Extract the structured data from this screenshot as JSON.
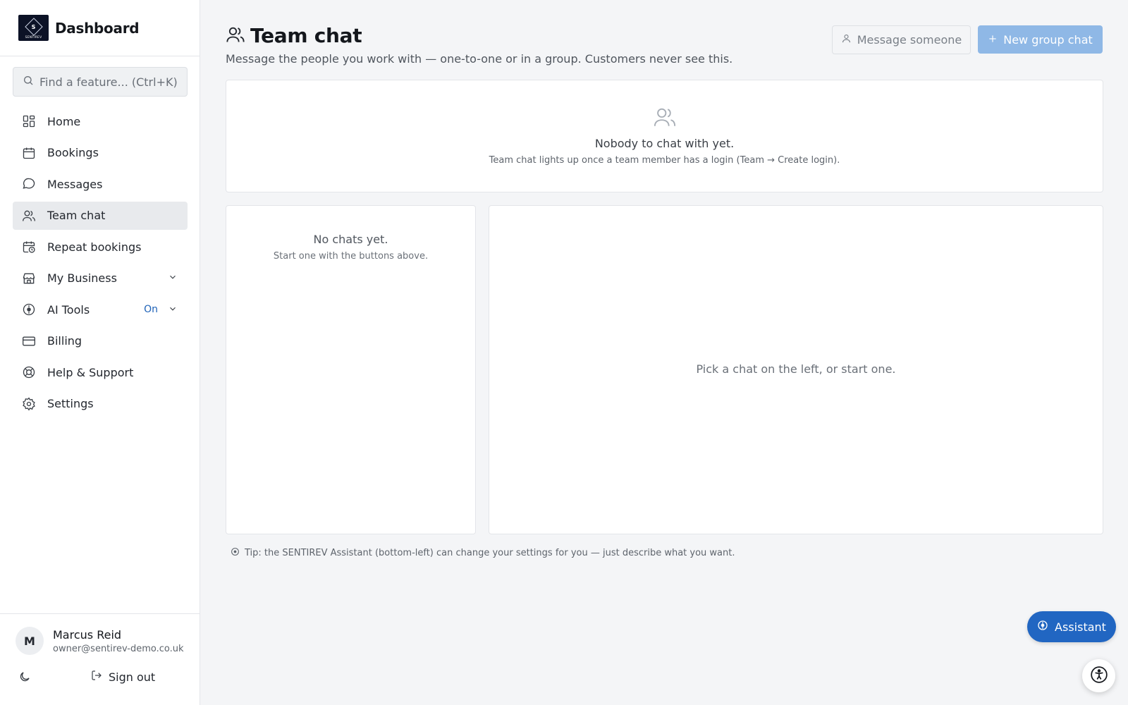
{
  "brand": {
    "title": "Dashboard",
    "logo_letter": "S",
    "logo_text": "SENTIREV"
  },
  "search": {
    "placeholder": "Find a feature...  (Ctrl+K)"
  },
  "sidebar": {
    "items": [
      {
        "label": "Home",
        "icon": "grid-icon"
      },
      {
        "label": "Bookings",
        "icon": "calendar-icon"
      },
      {
        "label": "Messages",
        "icon": "chat-bubble-icon"
      },
      {
        "label": "Team chat",
        "icon": "users-icon",
        "active": true
      },
      {
        "label": "Repeat bookings",
        "icon": "calendar-clock-icon"
      },
      {
        "label": "My Business",
        "icon": "store-icon",
        "expandable": true
      },
      {
        "label": "AI Tools",
        "icon": "ai-icon",
        "badge": "On",
        "expandable": true
      },
      {
        "label": "Billing",
        "icon": "credit-card-icon"
      },
      {
        "label": "Help & Support",
        "icon": "lifebuoy-icon"
      },
      {
        "label": "Settings",
        "icon": "gear-icon"
      }
    ]
  },
  "user": {
    "initial": "M",
    "name": "Marcus Reid",
    "email": "owner@sentirev-demo.co.uk",
    "sign_out": "Sign out"
  },
  "page": {
    "title": "Team chat",
    "subtitle": "Message the people you work with — one-to-one or in a group. Customers never see this.",
    "message_someone": "Message someone",
    "new_group_chat": "New group chat"
  },
  "empty_state": {
    "title": "Nobody to chat with yet.",
    "subtitle": "Team chat lights up once a team member has a login (Team → Create login)."
  },
  "chat_list": {
    "title": "No chats yet.",
    "subtitle": "Start one with the buttons above."
  },
  "chat_pane": {
    "hint": "Pick a chat on the left, or start one."
  },
  "tip": "Tip: the SENTIREV Assistant (bottom-left) can change your settings for you — just describe what you want.",
  "assistant": {
    "label": "Assistant"
  },
  "colors": {
    "accent": "#2166c2",
    "accent_disabled": "#8fb8e6",
    "badge": "#1f63b8"
  }
}
